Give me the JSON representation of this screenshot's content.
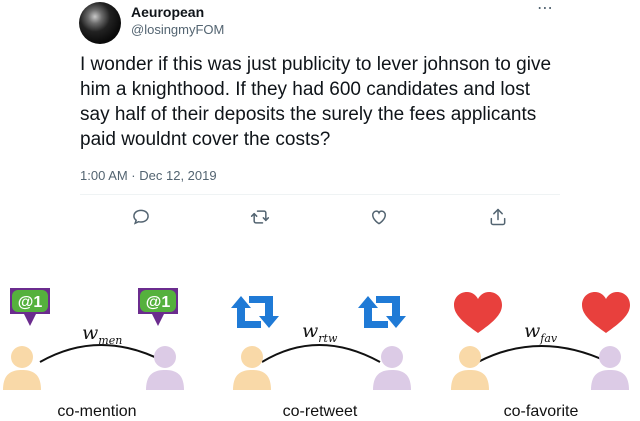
{
  "tweet": {
    "display_name": "Aeuropean",
    "handle": "@losingmyFOM",
    "text": "I wonder if this was just publicity to lever johnson to give him a knighthood. If they had 600 candidates and lost say half of their deposits the surely the fees applicants paid wouldnt cover the costs?",
    "timestamp": "1:00 AM · Dec 12, 2019",
    "more_icon": "more-horizontal-icon",
    "actions": [
      "reply-icon",
      "retweet-icon",
      "like-icon",
      "share-icon"
    ]
  },
  "diagram": {
    "groups": [
      {
        "caption": "co-mention",
        "weight_base": "w",
        "weight_sub": "men",
        "icon": "mention-badge-icon"
      },
      {
        "caption": "co-retweet",
        "weight_base": "w",
        "weight_sub": "rtw",
        "icon": "retweet-arrows-icon"
      },
      {
        "caption": "co-favorite",
        "weight_base": "w",
        "weight_sub": "fav",
        "icon": "heart-icon"
      }
    ],
    "colors": {
      "user_left": "#f9d9a8",
      "user_right": "#dccbe6",
      "mention_green": "#55b13d",
      "mention_purple": "#6b2c8e",
      "retweet_blue": "#1f7ad6",
      "heart_red": "#e8403d"
    }
  }
}
